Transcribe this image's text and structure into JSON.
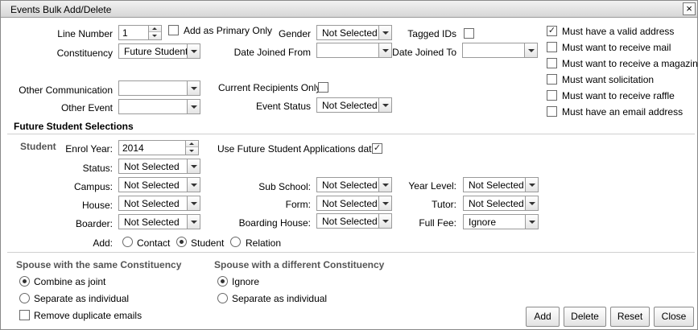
{
  "window": {
    "title": "Events Bulk Add/Delete",
    "close_glyph": "×"
  },
  "top": {
    "line_number": {
      "label": "Line Number",
      "value": "1"
    },
    "primary_only": {
      "label": "Add as Primary Only",
      "checked": false
    },
    "gender": {
      "label": "Gender",
      "value": "Not Selected"
    },
    "tagged_ids": {
      "label": "Tagged IDs",
      "checked": false
    },
    "constituency": {
      "label": "Constituency",
      "value": "Future Student"
    },
    "date_joined_from": {
      "label": "Date Joined From",
      "value": ""
    },
    "date_joined_to": {
      "label": "Date Joined To",
      "value": ""
    },
    "other_communication": {
      "label": "Other Communication",
      "value": ""
    },
    "current_recipients_only": {
      "label": "Current Recipients Only",
      "checked": false
    },
    "other_event": {
      "label": "Other Event",
      "value": ""
    },
    "event_status": {
      "label": "Event Status",
      "value": "Not Selected"
    }
  },
  "requirements": [
    {
      "label": "Must have a valid address",
      "checked": true
    },
    {
      "label": "Must want to receive mail",
      "checked": false
    },
    {
      "label": "Must want to receive a magazine",
      "checked": false
    },
    {
      "label": "Must want solicitation",
      "checked": false
    },
    {
      "label": "Must want to receive raffle",
      "checked": false
    },
    {
      "label": "Must have an email address",
      "checked": false
    }
  ],
  "future": {
    "heading": "Future Student Selections",
    "student_label": "Student",
    "enrol_year": {
      "label": "Enrol Year:",
      "value": "2014"
    },
    "use_applications": {
      "label": "Use Future Student Applications data:",
      "checked": true
    },
    "status": {
      "label": "Status:",
      "value": "Not Selected"
    },
    "campus": {
      "label": "Campus:",
      "value": "Not Selected"
    },
    "sub_school": {
      "label": "Sub School:",
      "value": "Not Selected"
    },
    "year_level": {
      "label": "Year Level:",
      "value": "Not Selected"
    },
    "house": {
      "label": "House:",
      "value": "Not Selected"
    },
    "form": {
      "label": "Form:",
      "value": "Not Selected"
    },
    "tutor": {
      "label": "Tutor:",
      "value": "Not Selected"
    },
    "boarder": {
      "label": "Boarder:",
      "value": "Not Selected"
    },
    "boarding_house": {
      "label": "Boarding House:",
      "value": "Not Selected"
    },
    "full_fee": {
      "label": "Full Fee:",
      "value": "Ignore"
    },
    "add": {
      "label": "Add:",
      "options": [
        "Contact",
        "Student",
        "Relation"
      ],
      "selected": "Student"
    }
  },
  "spouse_same": {
    "heading": "Spouse with the same Constituency",
    "options": [
      "Combine as joint",
      "Separate as individual"
    ],
    "selected": "Combine as joint",
    "remove_duplicates": {
      "label": "Remove duplicate emails",
      "checked": false
    }
  },
  "spouse_diff": {
    "heading": "Spouse with a different Constituency",
    "options": [
      "Ignore",
      "Separate as individual"
    ],
    "selected": "Ignore"
  },
  "buttons": {
    "add": "Add",
    "delete": "Delete",
    "reset": "Reset",
    "close": "Close"
  },
  "icons": {
    "check_glyph": "✓",
    "dropdown": "chevron-down-icon",
    "spinner": "spinner-arrows-icon"
  }
}
